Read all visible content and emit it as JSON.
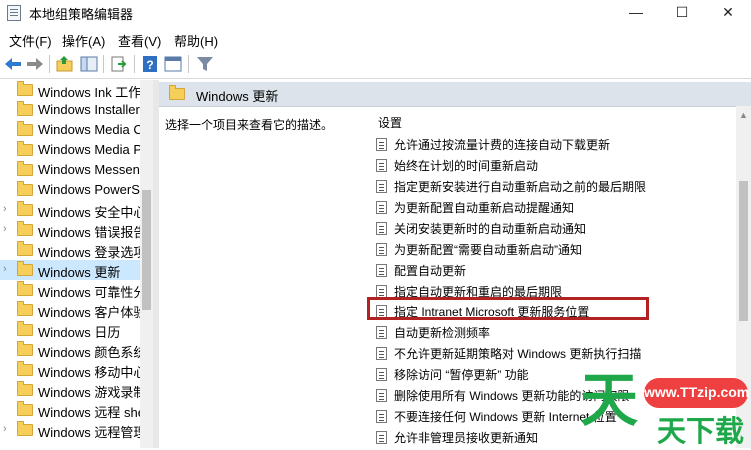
{
  "window": {
    "title": "本地组策略编辑器",
    "minimize": "—",
    "maximize": "☐",
    "close": "✕"
  },
  "menu": {
    "file": "文件(F)",
    "action": "操作(A)",
    "view": "查看(V)",
    "help": "帮助(H)"
  },
  "tree": {
    "items": [
      {
        "label": "Windows Ink 工作区",
        "expandable": false
      },
      {
        "label": "Windows Installer",
        "expandable": false
      },
      {
        "label": "Windows Media Center",
        "expandable": false
      },
      {
        "label": "Windows Media Player",
        "expandable": false
      },
      {
        "label": "Windows Messenger",
        "expandable": false
      },
      {
        "label": "Windows PowerShell",
        "expandable": false
      },
      {
        "label": "Windows 安全中心",
        "expandable": true
      },
      {
        "label": "Windows 错误报告",
        "expandable": true
      },
      {
        "label": "Windows 登录选项",
        "expandable": false
      },
      {
        "label": "Windows 更新",
        "expandable": true,
        "selected": true
      },
      {
        "label": "Windows 可靠性分析",
        "expandable": false
      },
      {
        "label": "Windows 客户体验",
        "expandable": false
      },
      {
        "label": "Windows 日历",
        "expandable": false
      },
      {
        "label": "Windows 颜色系统",
        "expandable": false
      },
      {
        "label": "Windows 移动中心",
        "expandable": false
      },
      {
        "label": "Windows 游戏录制",
        "expandable": false
      },
      {
        "label": "Windows 远程 shell",
        "expandable": false
      },
      {
        "label": "Windows 远程管理",
        "expandable": true
      }
    ]
  },
  "right": {
    "header": "Windows 更新",
    "description": "选择一个项目来查看它的描述。",
    "column_header": "设置",
    "policies": [
      "允许通过按流量计费的连接自动下载更新",
      "始终在计划的时间重新启动",
      "指定更新安装进行自动重新启动之前的最后期限",
      "为更新配置自动重新启动提醒通知",
      "关闭安装更新时的自动重新启动通知",
      "为更新配置“需要自动重新启动”通知",
      "配置自动更新",
      "指定自动更新和重启的最后期限",
      "指定 Intranet Microsoft 更新服务位置",
      "自动更新检测频率",
      "不允许更新延期策略对 Windows 更新执行扫描",
      "移除访问 “暂停更新” 功能",
      "删除使用所有 Windows 更新功能的访问权限",
      "不要连接任何 Windows 更新 Internet 位置",
      "允许非管理员接收更新通知"
    ],
    "highlighted_index": 8
  },
  "watermark": {
    "site": "www.TTzip.com",
    "logo": "天",
    "tail": "天下载"
  },
  "colors": {
    "selection": "#cce8ff",
    "header": "#dde3ea",
    "highlight_border": "#b22222",
    "watermark_green": "#1fa84a",
    "watermark_red": "#ee4040"
  }
}
